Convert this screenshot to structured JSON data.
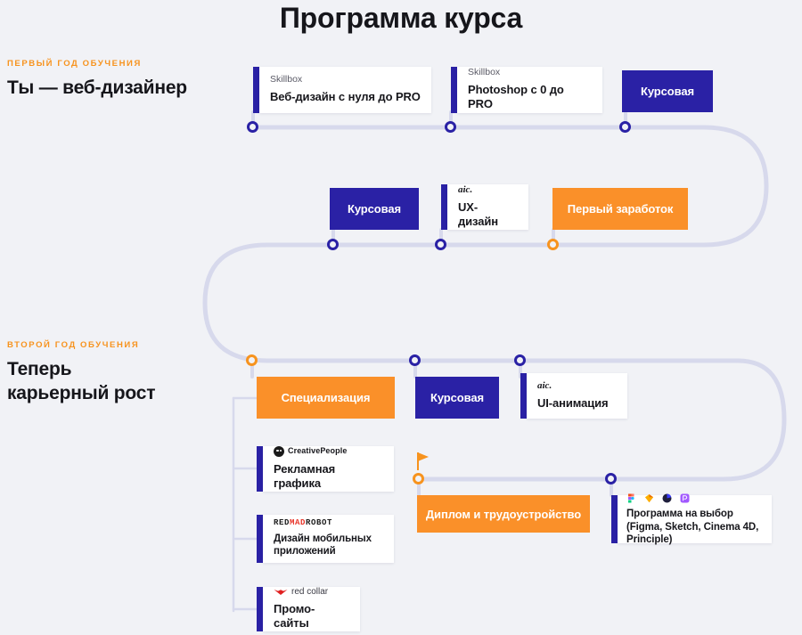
{
  "page": {
    "title": "Программа курса",
    "background": "#F1F2F6",
    "accent_blue": "#2A21A5",
    "accent_orange": "#FA9029",
    "kicker_orange": "#F7931E",
    "wire_color": "#D5D7EA"
  },
  "years": [
    {
      "kicker": "ПЕРВЫЙ ГОД ОБУЧЕНИЯ",
      "title_line1": "Ты — веб-дизайнер",
      "title_line2": ""
    },
    {
      "kicker": "ВТОРОЙ ГОД ОБУЧЕНИЯ",
      "title_line1": "Теперь",
      "title_line2": "карьерный рост"
    }
  ],
  "row1": [
    {
      "brand": "Skillbox",
      "title": "Веб-дизайн с нуля до PRO",
      "type": "card"
    },
    {
      "brand": "Skillbox",
      "title": "Photoshop с 0 до PRO",
      "type": "card"
    },
    {
      "title": "Курсовая",
      "type": "block-blue"
    }
  ],
  "row2": [
    {
      "title": "Курсовая",
      "type": "block-blue"
    },
    {
      "brand": "aic.",
      "title": "UX-дизайн",
      "type": "card"
    },
    {
      "title": "Первый заработок",
      "type": "block-orange"
    }
  ],
  "row3": [
    {
      "title": "Специализация",
      "type": "block-orange"
    },
    {
      "title": "Курсовая",
      "type": "block-blue"
    },
    {
      "brand": "aic.",
      "title": "UI-анимация",
      "type": "card"
    }
  ],
  "specializations": [
    {
      "brand": "CreativePeople",
      "brand_icon": "creativepeople-logo",
      "title": "Рекламная графика"
    },
    {
      "brand_prefix": "RED",
      "brand_mid": "MAD",
      "brand_suffix": "ROBOT",
      "brand_icon": "redmadrobot-logo",
      "title": "Дизайн мобильных приложений"
    },
    {
      "brand": "red collar",
      "brand_icon": "redcollar-logo",
      "title": "Промо-сайты"
    }
  ],
  "row4": [
    {
      "title": "Диплом и трудоустройство",
      "type": "block-orange",
      "icon": "flag-icon"
    },
    {
      "title": "Программа на выбор (Figma, Sketch, Cinema 4D, Principle)",
      "type": "card",
      "apps": [
        "figma-icon",
        "sketch-icon",
        "cinema4d-icon",
        "principle-icon"
      ]
    }
  ]
}
